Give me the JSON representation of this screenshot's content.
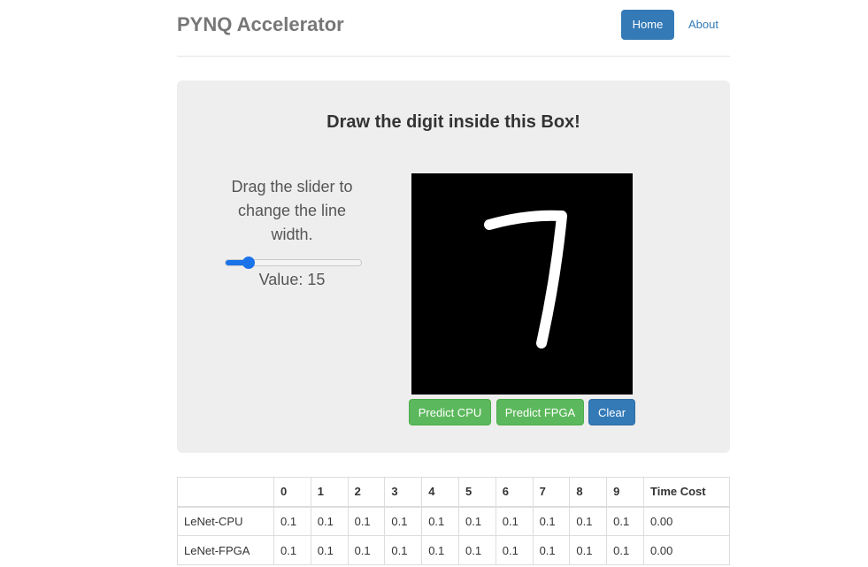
{
  "header": {
    "brand": "PYNQ Accelerator",
    "nav": {
      "home": "Home",
      "about": "About"
    }
  },
  "main": {
    "title": "Draw the digit inside this Box!",
    "slider": {
      "instructions": "Drag the slider to change the line width.",
      "value_label": "Value: 15",
      "value": 15,
      "min": 1,
      "max": 100
    },
    "buttons": {
      "predict_cpu": "Predict CPU",
      "predict_fpga": "Predict FPGA",
      "clear": "Clear"
    }
  },
  "results": {
    "headers": [
      "",
      "0",
      "1",
      "2",
      "3",
      "4",
      "5",
      "6",
      "7",
      "8",
      "9",
      "Time Cost"
    ],
    "rows": [
      {
        "name": "LeNet-CPU",
        "values": [
          "0.1",
          "0.1",
          "0.1",
          "0.1",
          "0.1",
          "0.1",
          "0.1",
          "0.1",
          "0.1",
          "0.1"
        ],
        "time": "0.00"
      },
      {
        "name": "LeNet-FPGA",
        "values": [
          "0.1",
          "0.1",
          "0.1",
          "0.1",
          "0.1",
          "0.1",
          "0.1",
          "0.1",
          "0.1",
          "0.1"
        ],
        "time": "0.00"
      }
    ]
  },
  "colors": {
    "primary": "#337ab7",
    "success": "#5cb85c",
    "slider_accent": "#1a73e8",
    "canvas_bg": "#000000",
    "stroke": "#ffffff"
  }
}
